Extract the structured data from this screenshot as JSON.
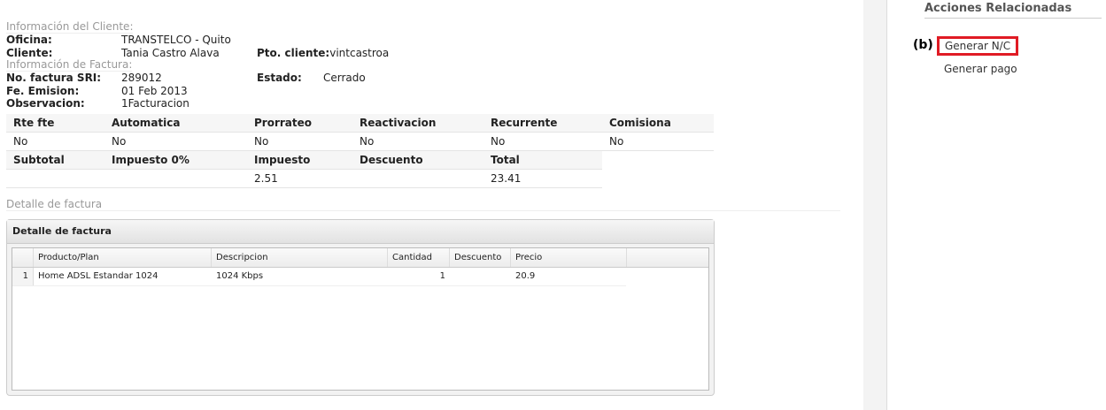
{
  "cliente": {
    "section": "Información del Cliente:",
    "oficina_label": "Oficina:",
    "oficina": "TRANSTELCO - Quito",
    "cliente_label": "Cliente:",
    "cliente": "Tania Castro Alava",
    "pto_label": "Pto. cliente:",
    "pto": "vintcastroa"
  },
  "factura": {
    "section": "Información de Factura:",
    "no_label": "No. factura SRI:",
    "no": "289012",
    "estado_label": "Estado:",
    "estado": "Cerrado",
    "fecha_label": "Fe. Emision:",
    "fecha": "01 Feb 2013",
    "obs_label": "Observacion:",
    "obs": "1Facturacion"
  },
  "flags": {
    "headers": [
      "Rte fte",
      "Automatica",
      "Prorrateo",
      "Reactivacion",
      "Recurrente",
      "Comisiona"
    ],
    "values": [
      "No",
      "No",
      "No",
      "No",
      "No",
      "No"
    ]
  },
  "totals": {
    "headers": [
      "Subtotal",
      "Impuesto 0%",
      "Impuesto",
      "Descuento",
      "Total"
    ],
    "values": [
      "",
      "",
      "2.51",
      "",
      "23.41"
    ]
  },
  "detalle_section": "Detalle de factura",
  "panel": {
    "title": "Detalle de factura",
    "columns": [
      "",
      "Producto/Plan",
      "Descripcion",
      "Cantidad",
      "Descuento",
      "Precio"
    ],
    "rows": [
      [
        "1",
        "Home ADSL Estandar 1024",
        "1024 Kbps",
        "1",
        "",
        "20.9"
      ]
    ]
  },
  "actions": {
    "title": "Acciones Relacionadas",
    "marker": "(b)",
    "items": [
      "Generar N/C",
      "Generar pago"
    ],
    "highlight_color": "#e01b24"
  }
}
